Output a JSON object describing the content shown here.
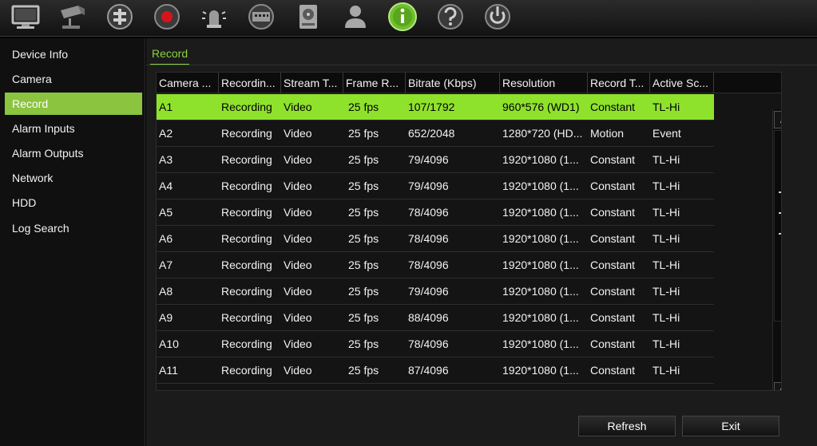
{
  "toolbar": {
    "icons": [
      "monitor-icon",
      "camera-icon",
      "ptz-icon",
      "record-icon",
      "alarm-icon",
      "network-icon",
      "hdd-icon",
      "user-icon",
      "info-icon",
      "help-icon",
      "power-icon"
    ],
    "active_icon": "info-icon",
    "accent": "#8bc43f",
    "record_red": "#d8141a"
  },
  "sidebar": {
    "items": [
      {
        "label": "Device Info"
      },
      {
        "label": "Camera"
      },
      {
        "label": "Record"
      },
      {
        "label": "Alarm Inputs"
      },
      {
        "label": "Alarm Outputs"
      },
      {
        "label": "Network"
      },
      {
        "label": "HDD"
      },
      {
        "label": "Log Search"
      }
    ],
    "active_index": 2
  },
  "tab": {
    "label": "Record"
  },
  "table": {
    "headers": [
      "Camera ...",
      "Recordin...",
      "Stream T...",
      "Frame R...",
      "Bitrate (Kbps)",
      "Resolution",
      "Record T...",
      "Active Sc..."
    ],
    "selected_row": 0,
    "rows": [
      [
        "A1",
        "Recording",
        "Video",
        "25 fps",
        "107/1792",
        "960*576 (WD1)",
        "Constant",
        "TL-Hi"
      ],
      [
        "A2",
        "Recording",
        "Video",
        "25 fps",
        "652/2048",
        "1280*720 (HD...",
        "Motion",
        "Event"
      ],
      [
        "A3",
        "Recording",
        "Video",
        "25 fps",
        "79/4096",
        "1920*1080 (1...",
        "Constant",
        "TL-Hi"
      ],
      [
        "A4",
        "Recording",
        "Video",
        "25 fps",
        "79/4096",
        "1920*1080 (1...",
        "Constant",
        "TL-Hi"
      ],
      [
        "A5",
        "Recording",
        "Video",
        "25 fps",
        "78/4096",
        "1920*1080 (1...",
        "Constant",
        "TL-Hi"
      ],
      [
        "A6",
        "Recording",
        "Video",
        "25 fps",
        "78/4096",
        "1920*1080 (1...",
        "Constant",
        "TL-Hi"
      ],
      [
        "A7",
        "Recording",
        "Video",
        "25 fps",
        "78/4096",
        "1920*1080 (1...",
        "Constant",
        "TL-Hi"
      ],
      [
        "A8",
        "Recording",
        "Video",
        "25 fps",
        "79/4096",
        "1920*1080 (1...",
        "Constant",
        "TL-Hi"
      ],
      [
        "A9",
        "Recording",
        "Video",
        "25 fps",
        "88/4096",
        "1920*1080 (1...",
        "Constant",
        "TL-Hi"
      ],
      [
        "A10",
        "Recording",
        "Video",
        "25 fps",
        "78/4096",
        "1920*1080 (1...",
        "Constant",
        "TL-Hi"
      ],
      [
        "A11",
        "Recording",
        "Video",
        "25 fps",
        "87/4096",
        "1920*1080 (1...",
        "Constant",
        "TL-Hi"
      ]
    ]
  },
  "scrollbar": {
    "up_icon": "chevron-up-icon",
    "down_icon": "chevron-down-icon"
  },
  "buttons": {
    "refresh": "Refresh",
    "exit": "Exit"
  }
}
